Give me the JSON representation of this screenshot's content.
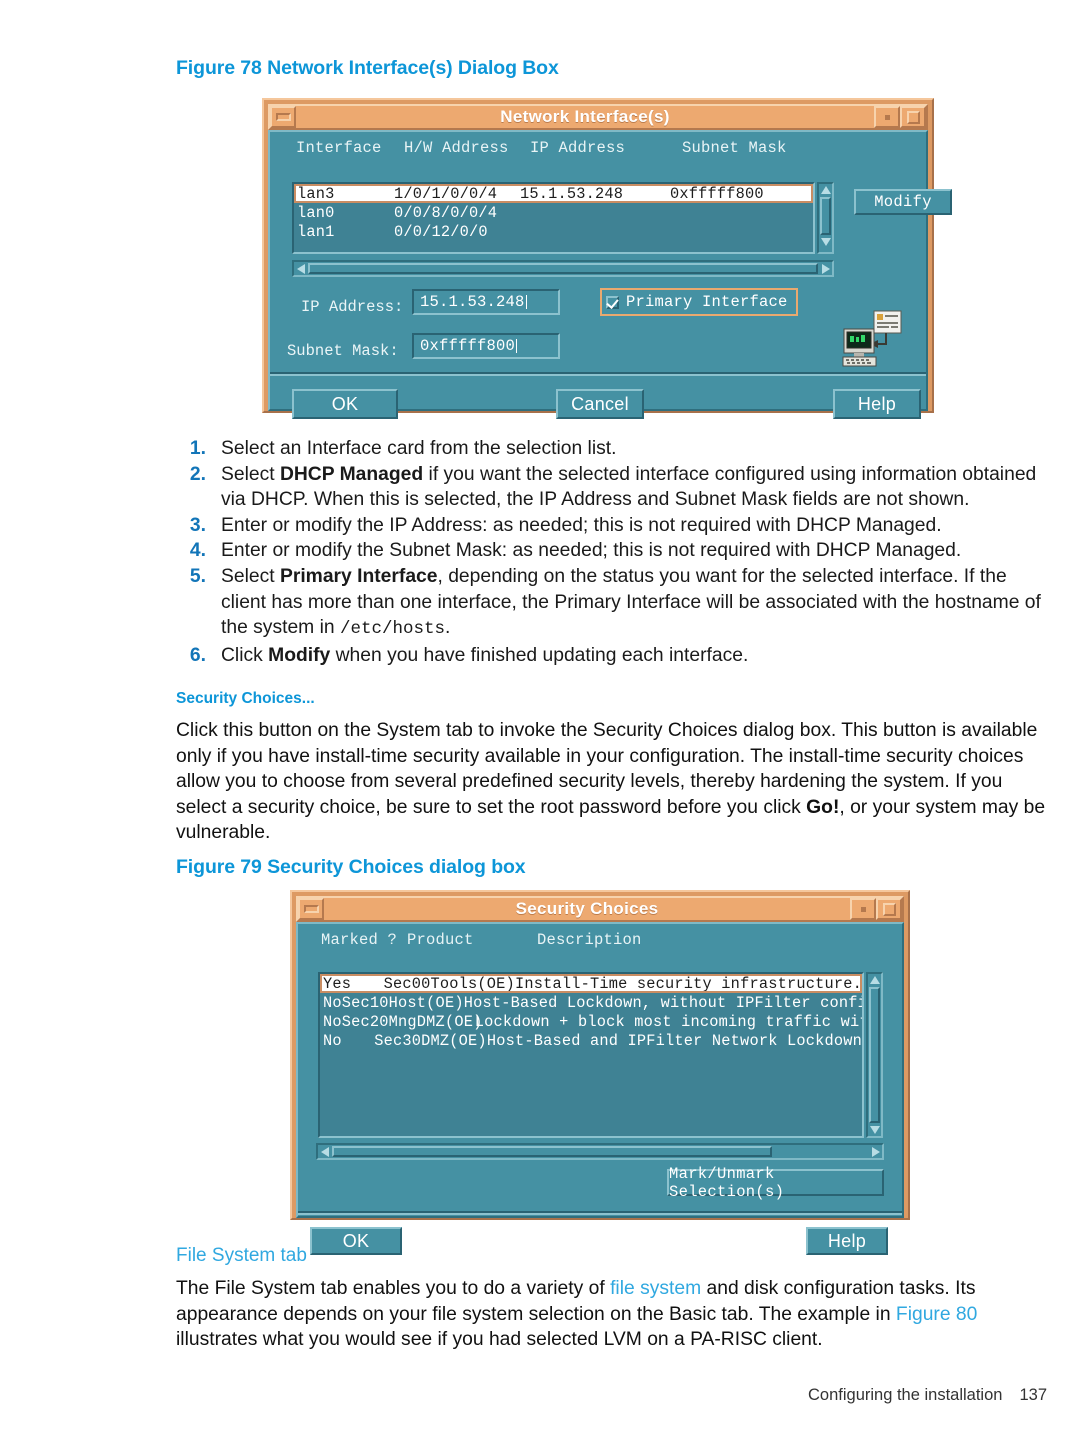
{
  "document": {
    "footer_text": "Configuring the installation",
    "page_number": "137"
  },
  "figure78": {
    "caption": "Figure 78 Network Interface(s) Dialog Box",
    "dialog": {
      "title": "Network Interface(s)",
      "titlebar_icons": [
        "minimize-icon",
        "restore-icon",
        "maximize-icon"
      ],
      "columns": [
        "Interface",
        "H/W Address",
        "IP Address",
        "Subnet Mask"
      ],
      "rows": [
        {
          "interface": "lan3",
          "hw_address": "1/0/1/0/0/4",
          "ip_address": "15.1.53.248",
          "subnet_mask": "0xfffff800",
          "selected": true
        },
        {
          "interface": "lan0",
          "hw_address": "0/0/8/0/0/4",
          "ip_address": "",
          "subnet_mask": "",
          "selected": false
        },
        {
          "interface": "lan1",
          "hw_address": "0/0/12/0/0",
          "ip_address": "",
          "subnet_mask": "",
          "selected": false
        }
      ],
      "modify_label": "Modify",
      "ip_label": "IP Address:",
      "ip_value": "15.1.53.248",
      "subnet_label": "Subnet Mask:",
      "subnet_value": "0xfffff800",
      "primary_checkbox_label": "Primary Interface",
      "primary_checked": true,
      "ok_label": "OK",
      "cancel_label": "Cancel",
      "help_label": "Help"
    }
  },
  "steps": [
    {
      "num": "1.",
      "html": "Select an Interface card from the selection list."
    },
    {
      "num": "2.",
      "html": "Select <b>DHCP Managed</b> if you want the selected interface configured using information obtained via DHCP. When this is selected, the IP Address and Subnet Mask fields are not shown."
    },
    {
      "num": "3.",
      "html": "Enter or modify the IP Address: as needed; this is not required with DHCP Managed."
    },
    {
      "num": "4.",
      "html": "Enter or modify the Subnet Mask: as needed; this is not required with DHCP Managed."
    },
    {
      "num": "5.",
      "html": "Select <b>Primary Interface</b>, depending on the status you want for the selected interface. If the client has more than one interface, the Primary Interface will be associated with the hostname of the system in <span class=\"mono\">/etc/hosts</span>."
    },
    {
      "num": "6.",
      "html": "Click <b>Modify</b> when you have finished updating each interface."
    }
  ],
  "security_section": {
    "heading": "Security Choices...",
    "body_html": "Click this button on the System tab to invoke the Security Choices dialog box. This button is available only if you have install-time security available in your configuration. The install-time security choices allow you to choose from several predefined security levels, thereby hardening the system. If you select a security choice, be sure to set the root password before you click <b>Go!</b>, or your system may be vulnerable."
  },
  "figure79": {
    "caption": "Figure 79 Security Choices dialog box",
    "dialog": {
      "title": "Security Choices",
      "titlebar_icons": [
        "minimize-icon",
        "restore-icon",
        "maximize-icon"
      ],
      "columns": [
        "Marked ?",
        "Product",
        "Description"
      ],
      "rows": [
        {
          "marked": "Yes",
          "product": "Sec00Tools(OE)",
          "description": "Install-Time security infrastructure.",
          "selected": true
        },
        {
          "marked": "No",
          "product": "Sec10Host(OE)",
          "description": "Host-Based Lockdown, without IPFilter config",
          "selected": false
        },
        {
          "marked": "No",
          "product": "Sec20MngDMZ(OE)",
          "description": "Lockdown + block most incoming traffic with",
          "selected": false
        },
        {
          "marked": "No",
          "product": "Sec30DMZ(OE)",
          "description": "Host-Based and IPFilter Network Lockdown",
          "selected": false
        }
      ],
      "mark_button_label": "Mark/Unmark Selection(s)",
      "ok_label": "OK",
      "help_label": "Help"
    }
  },
  "filesystem_section": {
    "heading": "File System tab",
    "body_html": "The File System tab enables you to do a variety of <span class=\"link\">file system</span> and disk configuration tasks. Its appearance depends on your file system selection on the Basic tab. The example in <span class=\"link\">Figure 80</span> illustrates what you would see if you had selected LVM on a PA-RISC client."
  },
  "colors": {
    "heading_blue": "#0d96d8",
    "link_blue": "#30a8e0",
    "dialog_titlebar": "#eda970",
    "dialog_frame": "#dd9a63",
    "dialog_body": "#4591a3",
    "listbox_bg": "#3f8294"
  }
}
